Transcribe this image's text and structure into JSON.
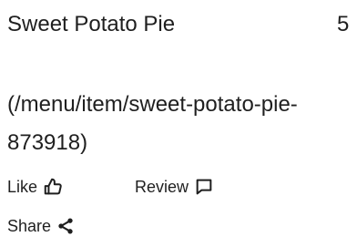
{
  "menu_item": {
    "name": "Sweet Potato Pie",
    "price": "5",
    "link_text": "(/menu/item/sweet-potato-pie-873918)"
  },
  "actions": {
    "like_label": "Like",
    "like_icon": "thumbs-up-icon",
    "review_label": "Review",
    "review_icon": "comment-icon",
    "share_label": "Share",
    "share_icon": "share-icon"
  }
}
